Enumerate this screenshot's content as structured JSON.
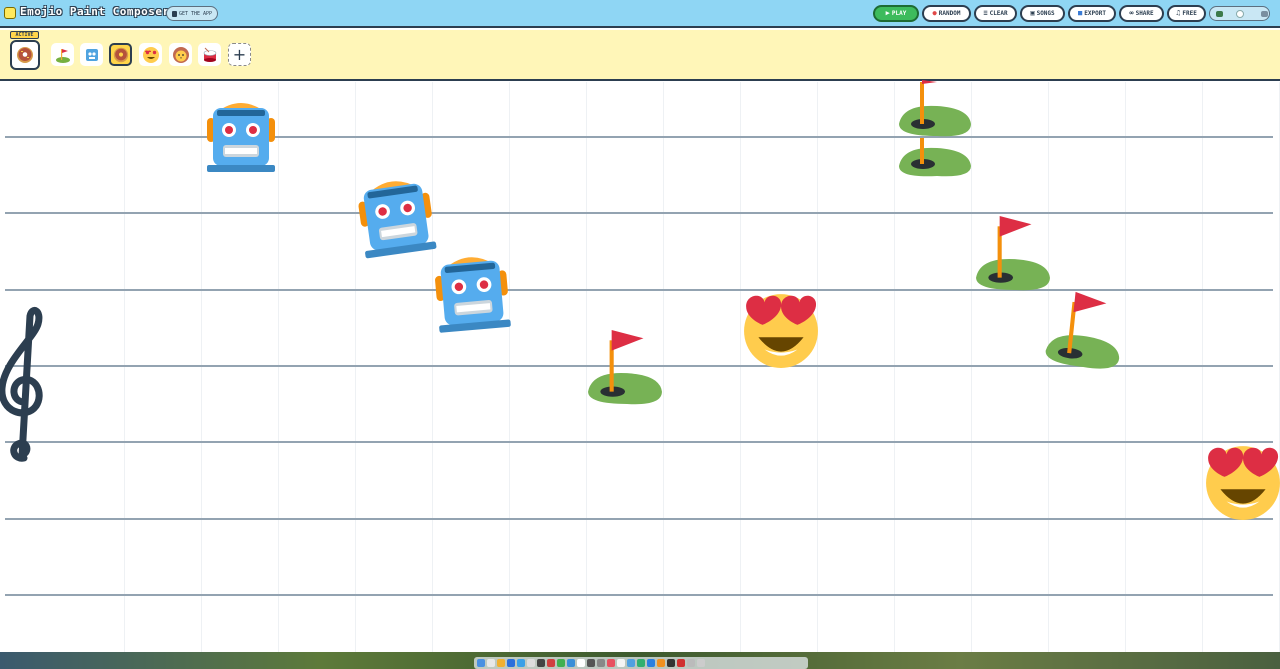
{
  "app": {
    "title": "Emojio Paint Composer",
    "get_app_label": "GET THE APP"
  },
  "toolbar": {
    "buttons": [
      {
        "label": "PLAY",
        "icon": "play-icon"
      },
      {
        "label": "RANDOM",
        "icon": "dice-icon"
      },
      {
        "label": "CLEAR",
        "icon": "trash-icon"
      },
      {
        "label": "SONGS",
        "icon": "save-icon"
      },
      {
        "label": "EXPORT",
        "icon": "export-icon"
      },
      {
        "label": "SHARE",
        "icon": "link-icon"
      },
      {
        "label": "FREE",
        "icon": "music-note-icon"
      }
    ],
    "volume": 0.5,
    "volume_low_icon": "turtle-icon",
    "volume_high_icon": "rabbit-icon"
  },
  "palette": {
    "active_label": "ACTIVE",
    "active_emoji": "donut",
    "items": [
      {
        "emoji": "golf-flag"
      },
      {
        "emoji": "robot"
      },
      {
        "emoji": "donut",
        "selected": true
      },
      {
        "emoji": "heart-eyes"
      },
      {
        "emoji": "lion"
      },
      {
        "emoji": "drum"
      }
    ],
    "add_label": "+"
  },
  "staff": {
    "clef": "𝄞",
    "line_count": 7,
    "notes": [
      {
        "emoji": "robot",
        "step": 1
      },
      {
        "emoji": "robot",
        "step": 2
      },
      {
        "emoji": "robot",
        "step": 3
      },
      {
        "emoji": "golf-flag",
        "step": 4
      },
      {
        "emoji": "heart-eyes",
        "step": 5
      },
      {
        "emoji": "golf-flag",
        "step": 6
      },
      {
        "emoji": "golf-flag",
        "step": 7
      },
      {
        "emoji": "golf-flag",
        "step": 8
      },
      {
        "emoji": "golf-flag",
        "step": 9
      },
      {
        "emoji": "heart-eyes",
        "step": 10
      }
    ]
  },
  "colors": {
    "topbar": "#8fd6f4",
    "palette_bg": "#fff6b8",
    "play_green": "#3dbb5c",
    "staff_line": "#93a3b1",
    "outline": "#2c3e50"
  }
}
